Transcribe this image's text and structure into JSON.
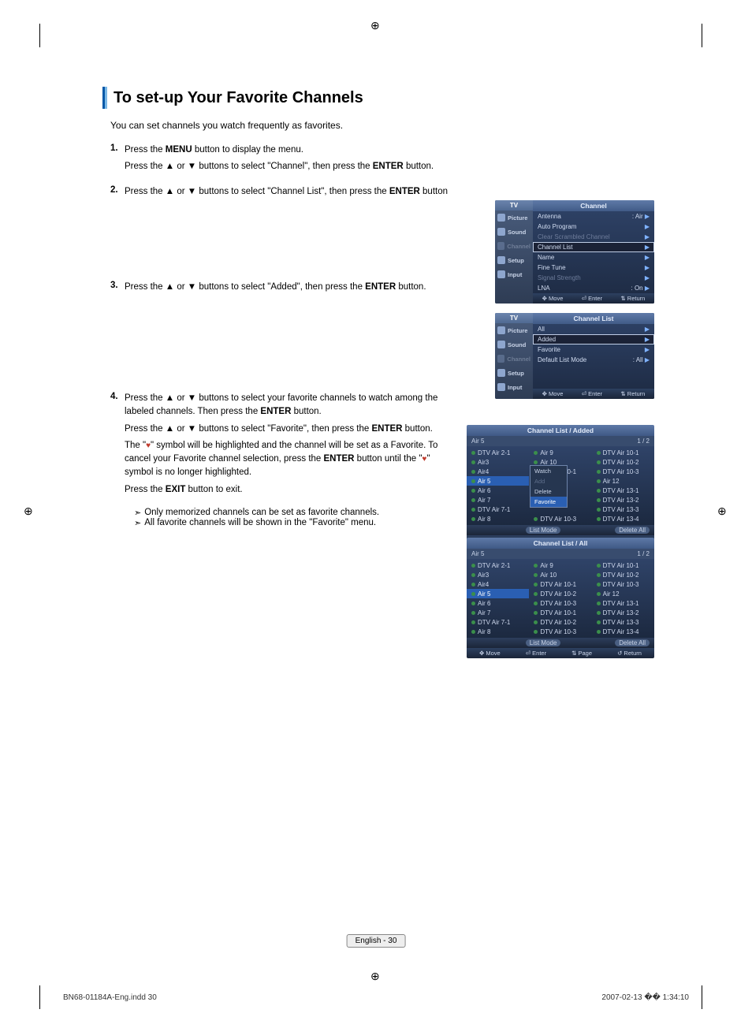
{
  "title": "To set-up Your Favorite Channels",
  "intro": "You can set channels you watch frequently as favorites.",
  "steps": {
    "s1": {
      "num": "1.",
      "line1_a": "Press the ",
      "line1_b": "MENU",
      "line1_c": " button to display the menu.",
      "line2_a": "Press the ▲ or ▼ buttons to select \"Channel\", then press the ",
      "line2_b": "ENTER",
      "line2_c": " button."
    },
    "s2": {
      "num": "2.",
      "line1_a": "Press the ▲ or ▼ buttons to select \"Channel List\", then press the ",
      "line1_b": "ENTER",
      "line1_c": " button"
    },
    "s3": {
      "num": "3.",
      "line1_a": "Press the ▲ or ▼ buttons to select \"Added\", then press the ",
      "line1_b": "ENTER",
      "line1_c": " button."
    },
    "s4": {
      "num": "4.",
      "p1_a": "Press the ▲ or ▼ buttons to select your favorite channels to watch among the labeled channels. Then press the ",
      "p1_b": "ENTER",
      "p1_c": " button.",
      "p2_a": "Press the ▲ or ▼ buttons to select \"Favorite\", then press the ",
      "p2_b": "ENTER",
      "p2_c": " button.",
      "p3_a": "The \"",
      "p3_b": "\" symbol will be highlighted and the channel will be set as a Favorite. To cancel your Favorite channel selection, press the ",
      "p3_c": "ENTER",
      "p3_d": " button until the \"",
      "p3_e": "\" symbol is no longer highlighted.",
      "p4_a": "Press the ",
      "p4_b": "EXIT",
      "p4_c": " button to exit."
    }
  },
  "notes": {
    "n1": "Only memorized channels can be set as favorite channels.",
    "n2": "All favorite channels will be shown in the \"Favorite\" menu."
  },
  "osd1": {
    "tv": "TV",
    "header": "Channel",
    "side": [
      "Picture",
      "Sound",
      "Channel",
      "Setup",
      "Input"
    ],
    "rows": [
      {
        "l": "Antenna",
        "r": ": Air"
      },
      {
        "l": "Auto Program",
        "r": ""
      },
      {
        "l": "Clear Scrambled Channel",
        "r": "",
        "dim": true
      },
      {
        "l": "Channel List",
        "r": "",
        "sel": true
      },
      {
        "l": "Name",
        "r": ""
      },
      {
        "l": "Fine Tune",
        "r": ""
      },
      {
        "l": "Signal Strength",
        "r": "",
        "dim": true
      },
      {
        "l": "LNA",
        "r": ": On"
      }
    ],
    "hints": [
      "Move",
      "Enter",
      "Return"
    ]
  },
  "osd2": {
    "tv": "TV",
    "header": "Channel List",
    "side": [
      "Picture",
      "Sound",
      "Channel",
      "Setup",
      "Input"
    ],
    "rows": [
      {
        "l": "All",
        "r": ""
      },
      {
        "l": "Added",
        "r": "",
        "sel": true
      },
      {
        "l": "Favorite",
        "r": ""
      },
      {
        "l": "Default List Mode",
        "r": ": All"
      }
    ],
    "hints": [
      "Move",
      "Enter",
      "Return"
    ]
  },
  "cl_added": {
    "header": "Channel List / Added",
    "current": "Air 5",
    "page": "1 / 2",
    "col1": [
      "DTV Air 2-1",
      "Air3",
      "Air4",
      "Air 5",
      "Air 6",
      "Air 7",
      "DTV Air 7-1",
      "Air 8"
    ],
    "sel1": 3,
    "col2": [
      "Air 9",
      "Air 10",
      "DTV Air 10-1",
      "",
      "",
      "",
      "",
      "DTV Air 10-3"
    ],
    "col3": [
      "DTV Air 10-1",
      "DTV Air 10-2",
      "DTV Air 10-3",
      "Air 12",
      "DTV Air 13-1",
      "DTV Air 13-2",
      "DTV Air 13-3",
      "DTV Air 13-4"
    ],
    "mini": [
      "Watch",
      "Add",
      "Delete",
      "Favorite"
    ],
    "mini_sel": 3,
    "mini_dim": 1,
    "foot_l": "List Mode",
    "foot_r": "Delete All",
    "hints": [
      "Move",
      "Enter",
      "",
      "Return"
    ]
  },
  "cl_all": {
    "header": "Channel List / All",
    "current": "Air 5",
    "page": "1 / 2",
    "col1": [
      "DTV Air 2-1",
      "Air3",
      "Air4",
      "Air 5",
      "Air 6",
      "Air 7",
      "DTV Air 7-1",
      "Air 8"
    ],
    "sel1": 3,
    "col2": [
      "Air 9",
      "Air 10",
      "DTV Air 10-1",
      "DTV Air 10-2",
      "DTV Air 10-3",
      "DTV Air 10-1",
      "DTV Air 10-2",
      "DTV Air 10-3"
    ],
    "col3": [
      "DTV Air 10-1",
      "DTV Air 10-2",
      "DTV Air 10-3",
      "Air 12",
      "DTV Air 13-1",
      "DTV Air 13-2",
      "DTV Air 13-3",
      "DTV Air 13-4"
    ],
    "foot_l": "List Mode",
    "foot_r": "Delete All",
    "hints": [
      "Move",
      "Enter",
      "Page",
      "Return"
    ]
  },
  "page_footer": "English - 30",
  "doc_footer_l": "BN68-01184A-Eng.indd   30",
  "doc_footer_r": "2007-02-13   �� 1:34:10"
}
